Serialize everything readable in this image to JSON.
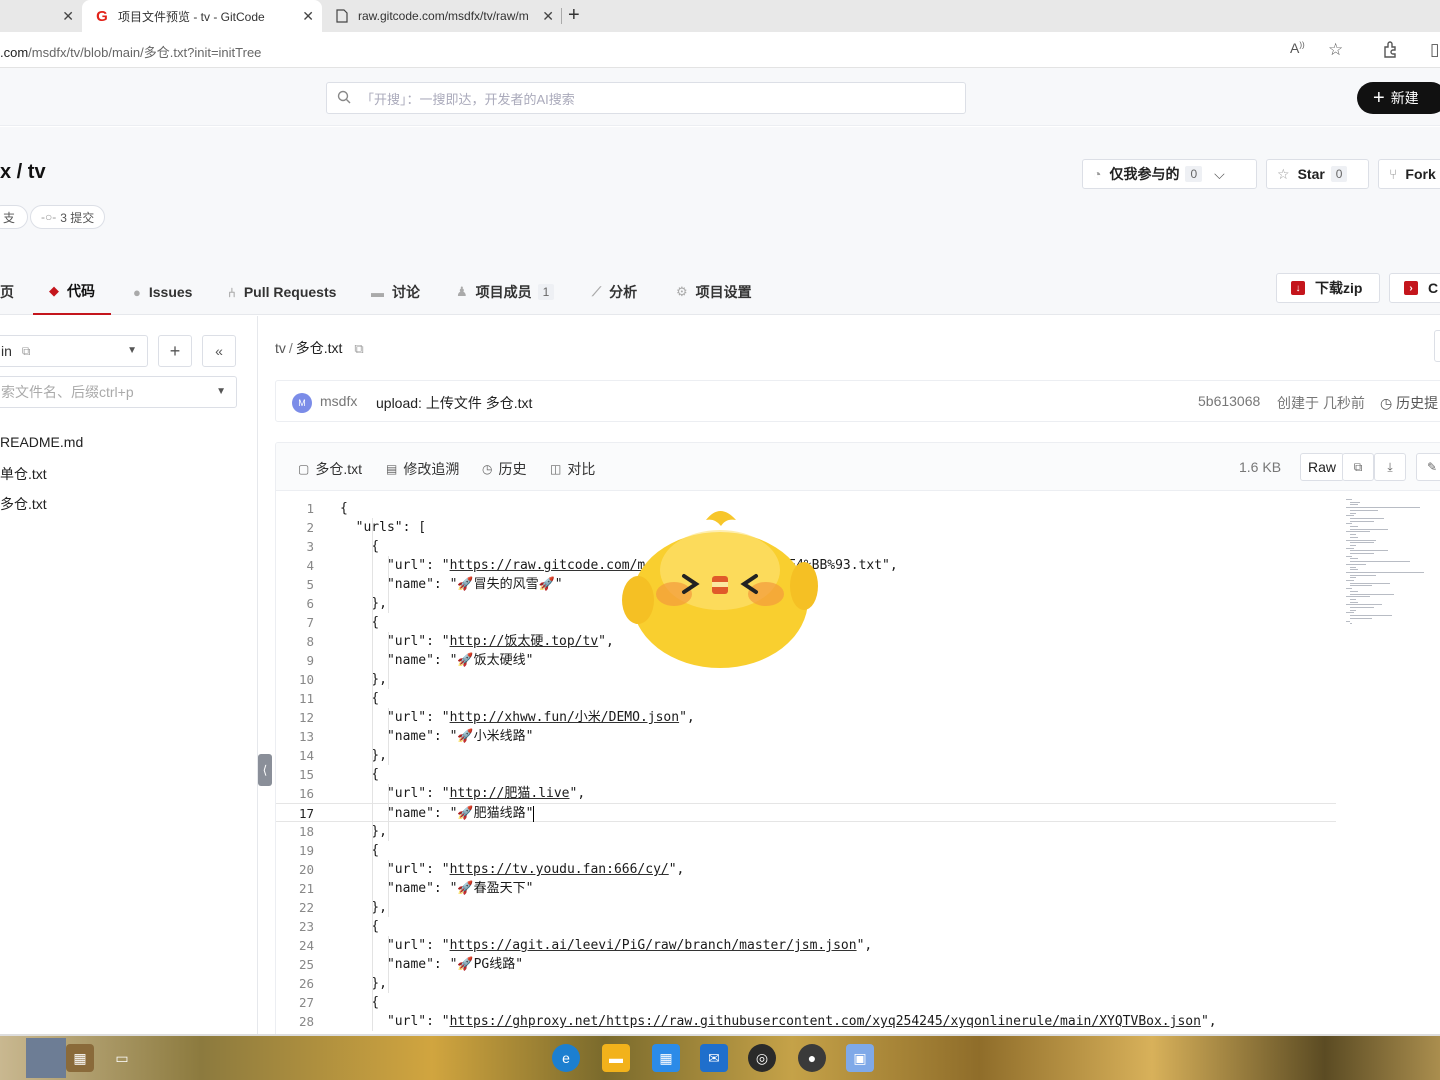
{
  "browser": {
    "tabs": [
      {
        "title": "",
        "active": false
      },
      {
        "title": "项目文件预览 - tv - GitCode",
        "active": true,
        "favicon": "G"
      },
      {
        "title": "raw.gitcode.com/msdfx/tv/raw/m",
        "active": false
      }
    ],
    "address": {
      "host": ".com",
      "path": "/msdfx/tv/blob/main/多仓.txt?init=initTree"
    }
  },
  "header": {
    "search_placeholder": "「开搜」：一搜即达，开发者的AI搜索",
    "new_button": "新建"
  },
  "repo": {
    "name": "x / tv",
    "branch_chip": "支",
    "commits_chip": "3 提交",
    "watch": {
      "label": "仅我参与的",
      "count": "0"
    },
    "star": {
      "label": "Star",
      "count": "0"
    },
    "fork": {
      "label": "Fork"
    },
    "nav": [
      {
        "label": "页",
        "icon": "home-icon"
      },
      {
        "label": "代码",
        "icon": "code-icon",
        "active": true
      },
      {
        "label": "Issues",
        "icon": "issues-icon"
      },
      {
        "label": "Pull Requests",
        "icon": "pull-request-icon"
      },
      {
        "label": "讨论",
        "icon": "discussion-icon"
      },
      {
        "label": "项目成员",
        "icon": "members-icon",
        "count": "1"
      },
      {
        "label": "分析",
        "icon": "analytics-icon"
      },
      {
        "label": "项目设置",
        "icon": "settings-icon"
      }
    ],
    "download_zip": "下载zip",
    "clone_partial": "C"
  },
  "tree": {
    "branch": "in",
    "search_placeholder": "索文件名、后缀ctrl+p",
    "files": [
      "README.md",
      "单仓.txt",
      "多仓.txt"
    ]
  },
  "file": {
    "breadcrumb": {
      "repo": "tv",
      "sep": "/",
      "file": "多仓.txt"
    },
    "commit": {
      "avatar": "M",
      "author": "msdfx",
      "message": "upload: 上传文件 多仓.txt",
      "sha": "5b613068",
      "created": "创建于 几秒前",
      "history": "历史提"
    },
    "toolbar": {
      "name": "多仓.txt",
      "blame": "修改追溯",
      "history": "历史",
      "compare": "对比",
      "size": "1.6 KB",
      "raw": "Raw"
    },
    "current_line": 17,
    "lines": [
      "{",
      "  \"urls\": [",
      "    {",
      "      \"url\": \"https://raw.gitcode.com/ms",
      "      \"name\": \"🚀冒失的风雪🚀\"",
      "    },",
      "    {",
      "      \"url\": \"http://饭太硬.top/tv\",",
      "      \"name\": \"🚀饭太硬线\"",
      "    },",
      "    {",
      "      \"url\": \"http://xhww.fun/小米/DEMO.json\",",
      "      \"name\": \"🚀小米线路\"",
      "    },",
      "    {",
      "      \"url\": \"http://肥猫.live\",",
      "      \"name\": \"🚀肥猫线路\"",
      "    },",
      "    {",
      "      \"url\": \"https://tv.youdu.fan:666/cy/\",",
      "      \"name\": \"🚀春盈天下\"",
      "    },",
      "    {",
      "      \"url\": \"https://agit.ai/leevi/PiG/raw/branch/master/jsm.json\",",
      "      \"name\": \"🚀PG线路\"",
      "    },",
      "    {",
      "      \"url\": \"https://ghproxy.net/https://raw.githubusercontent.com/xyq254245/xyqonlinerule/main/XYQTVBox.json\","
    ],
    "line4_tail": "0%95%E4%BB%93.txt\","
  },
  "colors": {
    "accent": "#c4151c",
    "link_text": "#1a1a1a",
    "mascot": "#f7cd2e"
  }
}
